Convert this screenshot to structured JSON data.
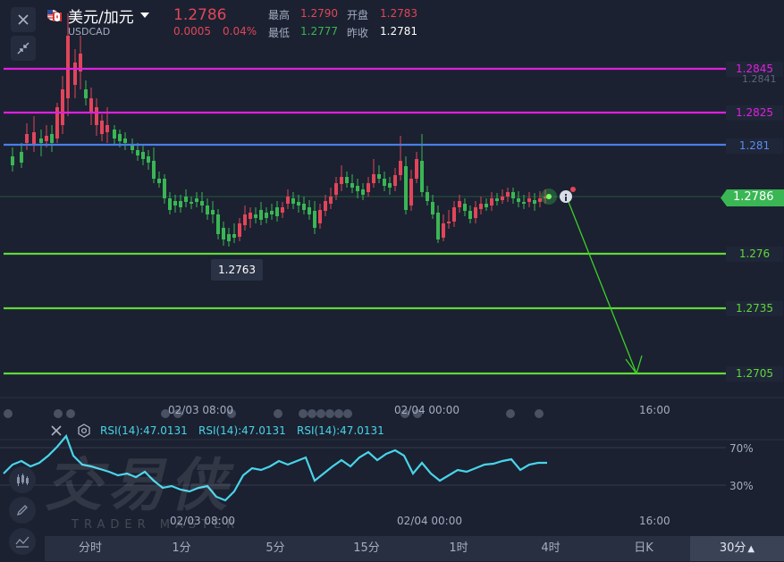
{
  "header": {
    "symbol_name": "美元/加元",
    "symbol_code": "USDCAD",
    "price": "1.2786",
    "change": "0.0005",
    "change_pct": "0.04%",
    "high_label": "最高",
    "high_value": "1.2790",
    "open_label": "开盘",
    "open_value": "1.2783",
    "low_label": "最低",
    "low_value": "1.2777",
    "prev_close_label": "昨收",
    "prev_close_value": "1.2781"
  },
  "price_axis": {
    "levels": [
      {
        "label": "1.2845",
        "color": "#e020e0"
      },
      {
        "label": "1.2825",
        "color": "#e020e0"
      },
      {
        "label": "1.281",
        "color": "#4a7ee8"
      },
      {
        "label": "1.276",
        "color": "#5fd83a"
      },
      {
        "label": "1.2735",
        "color": "#5fd83a"
      },
      {
        "label": "1.2705",
        "color": "#5fd83a"
      }
    ],
    "faint_label": "1.2841",
    "current_price": "1.2786",
    "low_marker": "1.2763"
  },
  "time_axis": {
    "main": [
      "02/03 08:00",
      "02/04 00:00",
      "16:00"
    ],
    "rsi": [
      "02/03 08:00",
      "02/04 00:00",
      "16:00"
    ]
  },
  "rsi": {
    "labels": [
      "RSI(14):47.0131",
      "RSI(14):47.0131",
      "RSI(14):47.0131"
    ],
    "level_high": "70%",
    "level_low": "30%",
    "color": "#49d4ea"
  },
  "watermark": {
    "text": "交易侠",
    "subtext": "TRADER MASTER"
  },
  "timeframes": {
    "items": [
      "分时",
      "1分",
      "5分",
      "15分",
      "1时",
      "4时",
      "日K"
    ],
    "selected": "30分",
    "selected_arrow": "▲"
  },
  "colors": {
    "up": "#e2455a",
    "down": "#3ab654",
    "background": "#1b2130"
  }
}
